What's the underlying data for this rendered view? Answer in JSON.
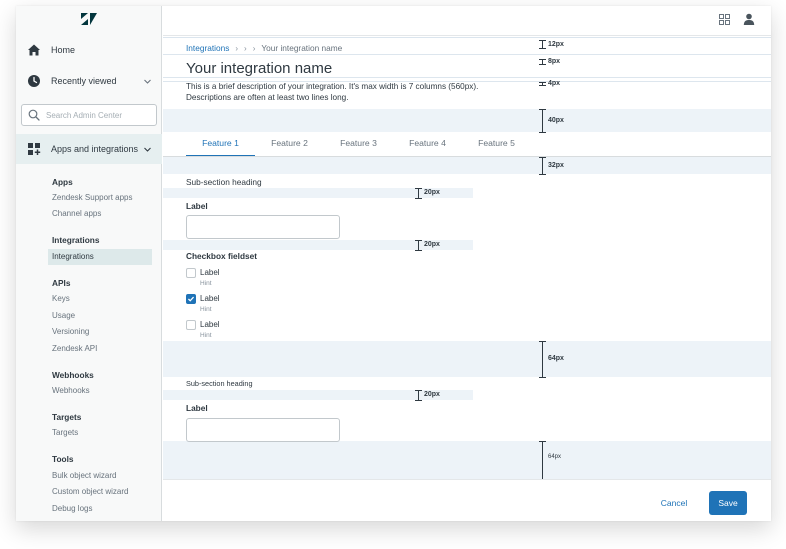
{
  "sidebar": {
    "home_label": "Home",
    "recent_label": "Recently viewed",
    "search_placeholder": "Search Admin Center",
    "apps_label": "Apps and integrations",
    "groups": [
      {
        "heading": "Apps",
        "items": [
          "Zendesk Support apps",
          "Channel apps"
        ]
      },
      {
        "heading": "Integrations",
        "items": [
          "Integrations"
        ]
      },
      {
        "heading": "APIs",
        "items": [
          "Keys",
          "Usage",
          "Versioning",
          "Zendesk API"
        ]
      },
      {
        "heading": "Webhooks",
        "items": [
          "Webhooks"
        ]
      },
      {
        "heading": "Targets",
        "items": [
          "Targets"
        ]
      },
      {
        "heading": "Tools",
        "items": [
          "Bulk object wizard",
          "Custom object wizard",
          "Debug logs"
        ]
      }
    ]
  },
  "breadcrumb": {
    "root": "Integrations",
    "current": "Your integration name"
  },
  "page": {
    "title": "Your integration name",
    "description": "This is a brief description of your integration. It's max width is 7 columns (560px). Descriptions are often at least two lines long."
  },
  "tabs": [
    "Feature 1",
    "Feature 2",
    "Feature 3",
    "Feature 4",
    "Feature 5"
  ],
  "section1": {
    "heading": "Sub-section heading",
    "field_label": "Label"
  },
  "fieldset": {
    "title": "Checkbox fieldset",
    "options": [
      {
        "label": "Label",
        "hint": "Hint",
        "checked": false
      },
      {
        "label": "Label",
        "hint": "Hint",
        "checked": true
      },
      {
        "label": "Label",
        "hint": "Hint",
        "checked": false
      }
    ]
  },
  "section2": {
    "heading": "Sub-section heading",
    "field_label": "Label"
  },
  "spacers": {
    "s12": "12px",
    "s8": "8px",
    "s4": "4px",
    "s40": "40px",
    "s32": "32px",
    "s20a": "20px",
    "s20b": "20px",
    "s64a": "64px",
    "s20c": "20px",
    "s64b": "64px"
  },
  "footer": {
    "cancel": "Cancel",
    "save": "Save"
  },
  "colors": {
    "accent": "#1f73b7",
    "band": "#edf3f8",
    "sidebar_active": "#e6eff0"
  }
}
